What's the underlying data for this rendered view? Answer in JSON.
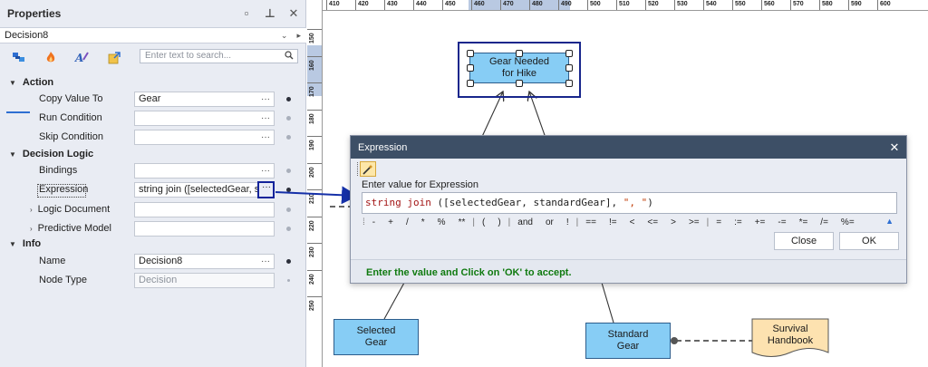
{
  "panel": {
    "title": "Properties",
    "object_name": "Decision8",
    "search_placeholder": "Enter text to search...",
    "categories": [
      {
        "label": "Action"
      },
      {
        "label": "Decision Logic"
      },
      {
        "label": "Info"
      }
    ],
    "props": [
      {
        "label": "Copy Value To",
        "value": "Gear",
        "has_dots": true,
        "set": true
      },
      {
        "label": "Run Condition",
        "value": "",
        "has_dots": true,
        "set": false
      },
      {
        "label": "Skip Condition",
        "value": "",
        "has_dots": true,
        "set": false
      },
      {
        "label": "Bindings",
        "value": "",
        "has_dots": true,
        "set": false
      },
      {
        "label": "Expression",
        "value": "string join ([selectedGear, sta",
        "has_dots": true,
        "set": true
      },
      {
        "label": "Logic Document",
        "value": "",
        "has_dots": false,
        "set": false,
        "expandable": true
      },
      {
        "label": "Predictive Model",
        "value": "",
        "has_dots": false,
        "set": false,
        "expandable": true
      },
      {
        "label": "Name",
        "value": "Decision8",
        "has_dots": true,
        "set": true
      },
      {
        "label": "Node Type",
        "value": "Decision",
        "has_dots": false,
        "set": false,
        "readonly": true
      }
    ],
    "tool_icons": [
      "properties-icon",
      "events-icon",
      "styles-icon",
      "validation-icon"
    ]
  },
  "ruler": {
    "h_labels": [
      "410",
      "420",
      "430",
      "440",
      "450",
      "460",
      "470",
      "480",
      "490",
      "500",
      "510",
      "520",
      "530",
      "540",
      "550",
      "560",
      "570",
      "580",
      "590",
      "600"
    ],
    "v_labels": [
      "150",
      "160",
      "170",
      "180",
      "190",
      "200",
      "210",
      "220",
      "230",
      "240",
      "250"
    ]
  },
  "canvas": {
    "nodes": [
      {
        "id": "gear-needed",
        "label": "Gear Needed for Hike"
      },
      {
        "id": "selected-gear",
        "label": "Selected Gear"
      },
      {
        "id": "standard-gear",
        "label": "Standard Gear"
      },
      {
        "id": "survival-handbook",
        "label": "Survival Handbook"
      }
    ]
  },
  "dialog": {
    "title": "Expression",
    "prompt": "Enter value for Expression",
    "expression": {
      "kw": "string join",
      "rest": " ([selectedGear, standardGear], ",
      "str": "\", \"",
      "tail": ")"
    },
    "operators": [
      "-",
      "+",
      "/",
      "*",
      "%",
      "**",
      "|",
      "(",
      ")",
      "|",
      "and",
      "or",
      "!",
      "|",
      "==",
      "!=",
      "<",
      "<=",
      ">",
      ">=",
      "|",
      "=",
      ":=",
      "+=",
      "-=",
      "*=",
      "/=",
      "%="
    ],
    "close_label": "Close",
    "ok_label": "OK",
    "hint": "Enter the value and Click on 'OK' to accept."
  },
  "colors": {
    "node_fill": "#87cdf5",
    "selection_frame": "#18268c",
    "dialog_header": "#3d4f66",
    "hint_text": "#107a10",
    "handbook_fill": "#fde2b0"
  }
}
